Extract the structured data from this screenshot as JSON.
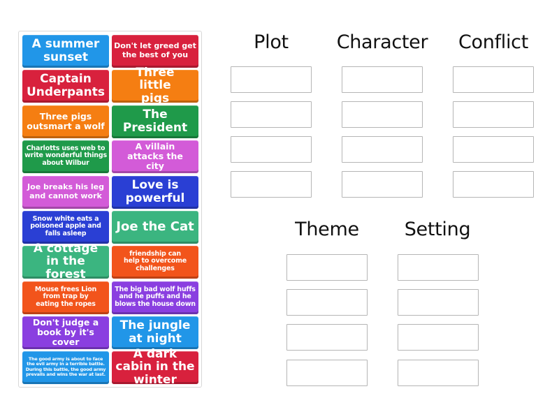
{
  "tray": {
    "tiles": [
      {
        "text": "A summer sunset",
        "color": "#2196e8"
      },
      {
        "text": "Don't let greed get the best of you",
        "color": "#d8213d"
      },
      {
        "text": "Captain Underpants",
        "color": "#d8213d"
      },
      {
        "text": "Three little pigs",
        "color": "#f57e12"
      },
      {
        "text": "Three pigs outsmart a wolf",
        "color": "#f57e12"
      },
      {
        "text": "The President",
        "color": "#1f9a4a"
      },
      {
        "text": "Charlotts uses web to write wonderful things about Wilbur",
        "color": "#1f9a4a"
      },
      {
        "text": "A villain attacks the city",
        "color": "#d35bd8"
      },
      {
        "text": "Joe breaks his leg and cannot work",
        "color": "#d35bd8"
      },
      {
        "text": "Love is powerful",
        "color": "#2a3fd4"
      },
      {
        "text": "Snow white eats a poisoned apple and falls asleep",
        "color": "#2a3fd4"
      },
      {
        "text": "Joe the Cat",
        "color": "#3bb580"
      },
      {
        "text": "A cottage in the forest",
        "color": "#3bb580"
      },
      {
        "text": "friendship can help to overcome challenges",
        "color": "#f2541b"
      },
      {
        "text": "Mouse frees Lion from trap by eating the ropes",
        "color": "#f2541b"
      },
      {
        "text": "The big bad wolf huffs and he puffs and he blows the house down",
        "color": "#8a3fe0"
      },
      {
        "text": "Don't judge a book by it's cover",
        "color": "#8a3fe0"
      },
      {
        "text": "The jungle at night",
        "color": "#2196e8"
      },
      {
        "text": "The good army is about to face the evil army in a terrible battle. During this battle, the good army prevails and wins the war at last.",
        "color": "#2196e8"
      },
      {
        "text": "A dark cabin in the winter",
        "color": "#d8213d"
      }
    ]
  },
  "categories": [
    {
      "label": "Plot",
      "slots": 4
    },
    {
      "label": "Character",
      "slots": 4
    },
    {
      "label": "Conflict",
      "slots": 4
    },
    {
      "label": "Theme",
      "slots": 4
    },
    {
      "label": "Setting",
      "slots": 4
    }
  ]
}
